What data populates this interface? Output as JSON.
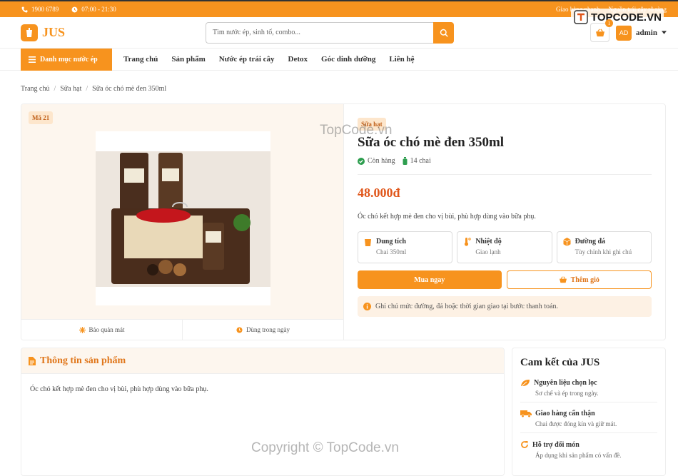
{
  "topbar": {
    "phone": "1900 6789",
    "hours": "07:00 - 21:30",
    "right_links": [
      "Giao hàng nhanh",
      "Nguồn trái cây rõ ràng"
    ]
  },
  "header": {
    "logo": "JUS",
    "search_placeholder": "Tìm nước ép, sinh tố, combo...",
    "cart_count": "1",
    "avatar": "AD",
    "username": "admin"
  },
  "nav": {
    "category": "Danh mục nước ép",
    "items": [
      "Trang chủ",
      "Sản phẩm",
      "Nước ép trái cây",
      "Detox",
      "Góc dinh dưỡng",
      "Liên hệ"
    ]
  },
  "breadcrumb": [
    "Trang chủ",
    "Sữa hạt",
    "Sữa óc chó mè đen 350ml"
  ],
  "product": {
    "code": "Mã 21",
    "features": [
      "Bảo quản mát",
      "Dùng trong ngày"
    ],
    "category": "Sữa hạt",
    "name": "Sữa óc chó mè đen 350ml",
    "stock": "Còn hàng",
    "sold": "14 chai",
    "price": "48.000đ",
    "description": "Óc chó kết hợp mè đen cho vị bùi, phù hợp dùng vào bữa phụ.",
    "specs": [
      {
        "title": "Dung tích",
        "value": "Chai 350ml"
      },
      {
        "title": "Nhiệt độ",
        "value": "Giao lạnh"
      },
      {
        "title": "Đường đá",
        "value": "Tùy chỉnh khi ghi chú"
      }
    ],
    "buy_label": "Mua ngay",
    "add_label": "Thêm giỏ",
    "note": "Ghi chú mức đường, đá hoặc thời gian giao tại bước thanh toán."
  },
  "info": {
    "title": "Thông tin sản phẩm",
    "body": "Óc chó kết hợp mè đen cho vị bùi, phù hợp dùng vào bữa phụ."
  },
  "commitment": {
    "title": "Cam kết của JUS",
    "items": [
      {
        "title": "Nguyên liệu chọn lọc",
        "desc": "Sơ chế và ép trong ngày."
      },
      {
        "title": "Giao hàng cẩn thận",
        "desc": "Chai được đóng kín và giữ mát."
      },
      {
        "title": "Hỗ trợ đổi món",
        "desc": "Áp dụng khi sản phẩm có vấn đề."
      }
    ]
  },
  "watermarks": {
    "brand": "TOPCODE.VN",
    "center": "TopCode.vn",
    "bottom": "Copyright © TopCode.vn"
  },
  "colors": {
    "accent": "#f7931e",
    "price": "#e0561a",
    "success": "#2e9e4f"
  }
}
